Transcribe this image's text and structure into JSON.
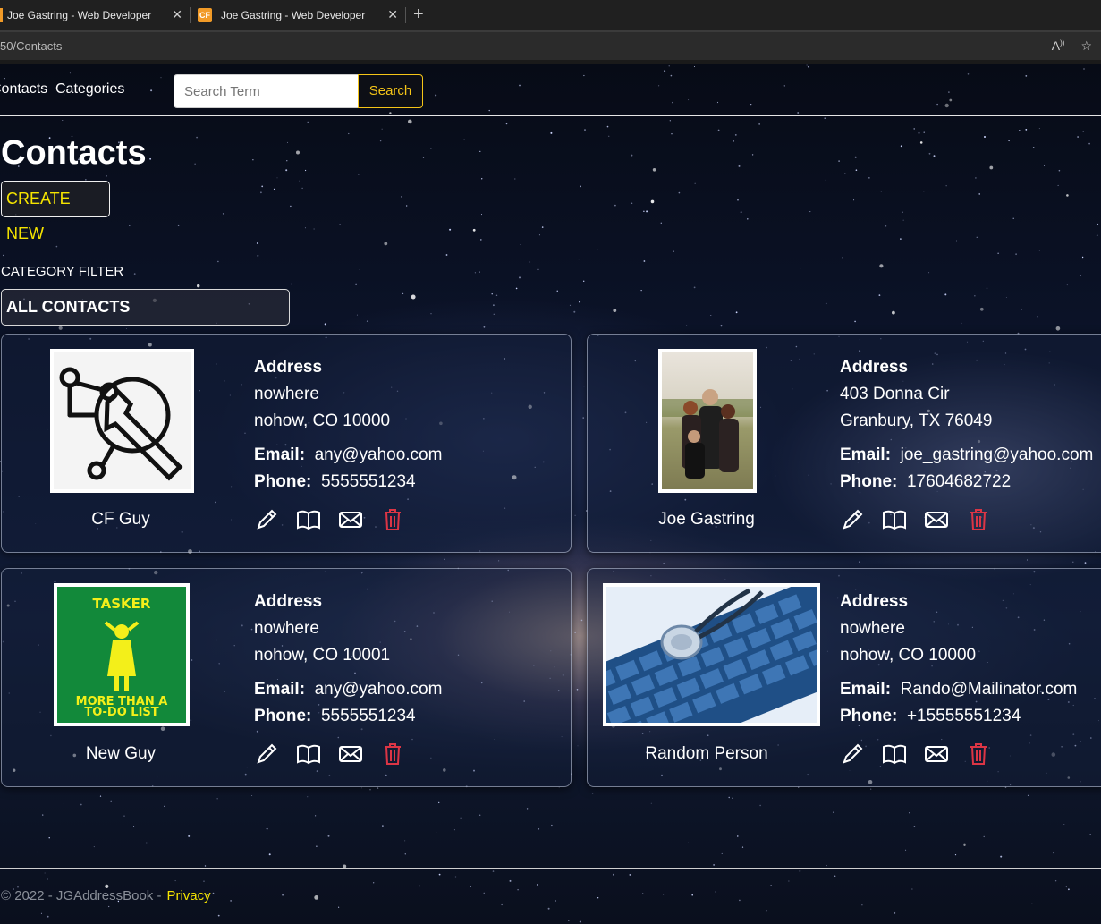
{
  "browser": {
    "tabs": [
      {
        "title": "Joe Gastring - Web Developer"
      },
      {
        "title": "Joe Gastring - Web Developer",
        "favicon": "CF"
      }
    ],
    "url": "50/Contacts"
  },
  "nav": {
    "contacts_label": "Contacts",
    "categories_label": "Categories",
    "search_placeholder": "Search Term",
    "search_button": "Search"
  },
  "main": {
    "title": "Contacts",
    "create_new": "CREATE NEW",
    "filter_label": "CATEGORY FILTER",
    "filter_selected": "ALL CONTACTS"
  },
  "labels": {
    "address": "Address",
    "email": "Email:",
    "phone": "Phone:"
  },
  "contacts": [
    {
      "name": "CF Guy",
      "address1": "nowhere",
      "address2": "nohow, CO 10000",
      "email": "any@yahoo.com",
      "phone": "5555551234"
    },
    {
      "name": "Joe Gastring",
      "address1": "403 Donna Cir",
      "address2": "Granbury, TX 76049",
      "email": "joe_gastring@yahoo.com",
      "phone": "17604682722"
    },
    {
      "name": "New Guy",
      "address1": "nowhere",
      "address2": "nohow, CO 10001",
      "email": "any@yahoo.com",
      "phone": "5555551234"
    },
    {
      "name": "Random Person",
      "address1": "nowhere",
      "address2": "nohow, CO 10000",
      "email": "Rando@Mailinator.com",
      "phone": "+15555551234"
    }
  ],
  "tasker_logo": {
    "top": "TASKER",
    "bottom1": "MORE THAN A",
    "bottom2": "TO-DO LIST"
  },
  "footer": {
    "copyright": "© 2022 - JGAddressBook -",
    "privacy": "Privacy"
  },
  "colors": {
    "accent_yellow": "#f5e400",
    "delete_red": "#dc3545",
    "search_border": "#f5c518"
  },
  "icons": [
    "edit-icon",
    "book-icon",
    "envelope-icon",
    "trash-icon"
  ]
}
